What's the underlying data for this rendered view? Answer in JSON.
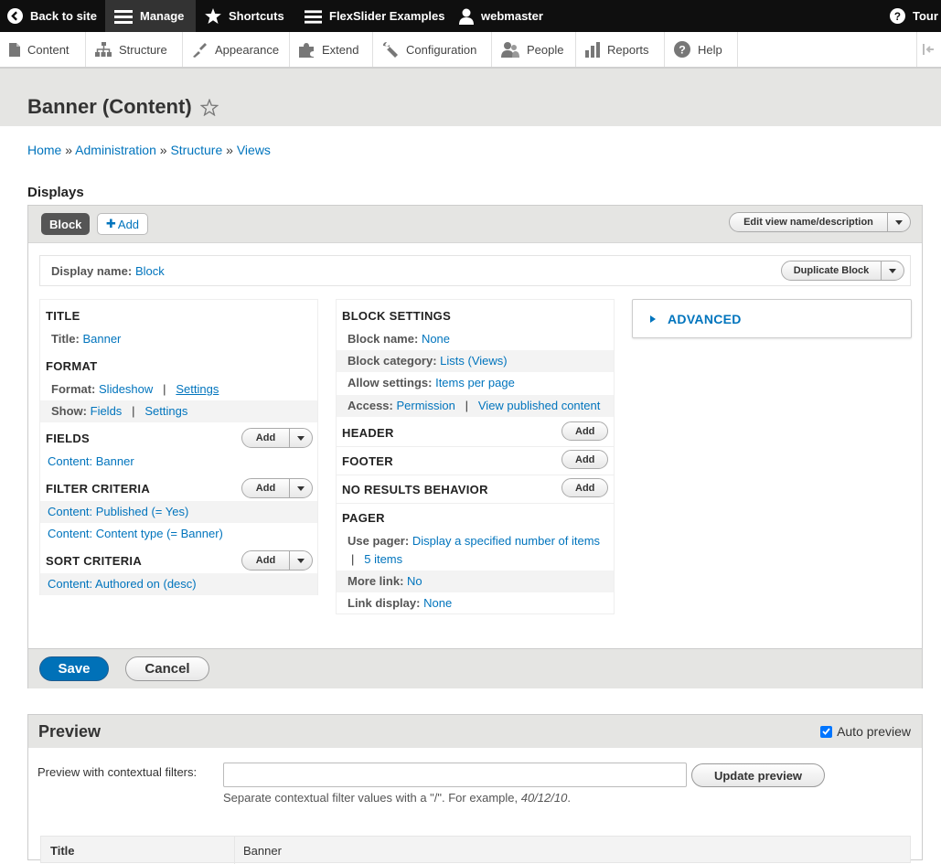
{
  "toolbar": {
    "back": "Back to site",
    "manage": "Manage",
    "shortcuts": "Shortcuts",
    "flexslider": "FlexSlider Examples",
    "user": "webmaster",
    "tour": "Tour"
  },
  "admin_menu": [
    "Content",
    "Structure",
    "Appearance",
    "Extend",
    "Configuration",
    "People",
    "Reports",
    "Help"
  ],
  "page": {
    "title": "Banner (Content)",
    "breadcrumb": [
      "Home",
      "Administration",
      "Structure",
      "Views"
    ],
    "breadcrumb_sep": "»",
    "displays_heading": "Displays"
  },
  "displays": {
    "active_tab": "Block",
    "add_label": "Add",
    "edit_view_label": "Edit view name/description",
    "display_name_label": "Display name:",
    "display_name_value": "Block",
    "duplicate_label": "Duplicate Block"
  },
  "left_col": {
    "title_heading": "TITLE",
    "title_label": "Title:",
    "title_value": "Banner",
    "format_heading": "FORMAT",
    "format_label": "Format:",
    "format_value": "Slideshow",
    "format_settings": "Settings",
    "show_label": "Show:",
    "show_value": "Fields",
    "show_settings": "Settings",
    "fields_heading": "FIELDS",
    "fields_items": [
      "Content: Banner"
    ],
    "filter_heading": "FILTER CRITERIA",
    "filter_items": [
      "Content: Published (= Yes)",
      "Content: Content type (= Banner)"
    ],
    "sort_heading": "SORT CRITERIA",
    "sort_items": [
      "Content: Authored on (desc)"
    ],
    "add_label": "Add",
    "pipe": "|"
  },
  "mid_col": {
    "block_settings_heading": "BLOCK SETTINGS",
    "block_name_label": "Block name:",
    "block_name_value": "None",
    "block_category_label": "Block category:",
    "block_category_value": "Lists (Views)",
    "allow_settings_label": "Allow settings:",
    "allow_settings_value": "Items per page",
    "access_label": "Access:",
    "access_value": "Permission",
    "access_value2": "View published content",
    "header_heading": "HEADER",
    "footer_heading": "FOOTER",
    "no_results_heading": "NO RESULTS BEHAVIOR",
    "pager_heading": "PAGER",
    "use_pager_label": "Use pager:",
    "use_pager_value": "Display a specified number of items",
    "use_pager_value2": "5 items",
    "more_link_label": "More link:",
    "more_link_value": "No",
    "link_display_label": "Link display:",
    "link_display_value": "None",
    "add_label": "Add",
    "pipe": "|"
  },
  "advanced": {
    "label": "ADVANCED"
  },
  "actions": {
    "save": "Save",
    "cancel": "Cancel"
  },
  "preview": {
    "heading": "Preview",
    "auto_preview_label": "Auto preview",
    "auto_preview_checked": true,
    "contextual_label": "Preview with contextual filters:",
    "contextual_value": "",
    "update_label": "Update preview",
    "help_text": "Separate contextual filter values with a \"/\". For example,",
    "help_example": "40/12/10",
    "help_end": ".",
    "table": {
      "col_label": "Title",
      "col_value": "Banner"
    }
  },
  "colors": {
    "link": "#0074bd",
    "primary_button": "#0071b8",
    "toolbar_bg": "#0f0f0f",
    "header_bg": "#e5e5e3"
  }
}
